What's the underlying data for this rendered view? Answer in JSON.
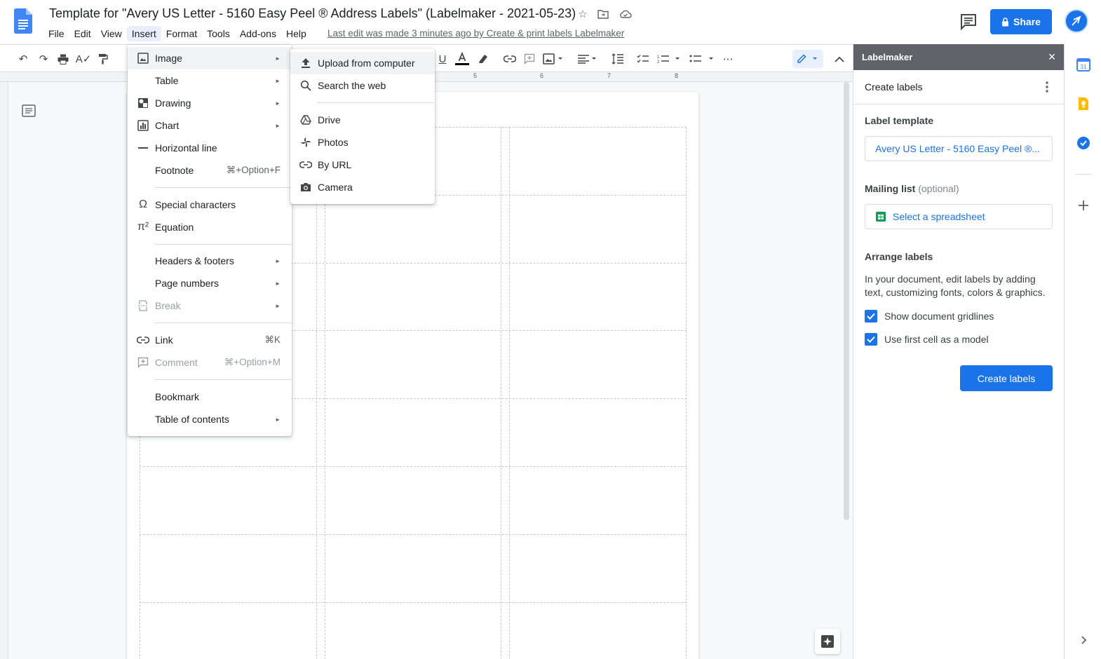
{
  "header": {
    "title": "Template for \"Avery US Letter - 5160 Easy Peel ® Address Labels\" (Labelmaker - 2021-05-23)",
    "menus": [
      "File",
      "Edit",
      "View",
      "Insert",
      "Format",
      "Tools",
      "Add-ons",
      "Help"
    ],
    "last_edit": "Last edit was made 3 minutes ago by Create & print labels Labelmaker",
    "share_label": "Share"
  },
  "ruler": {
    "numbers": [
      "5",
      "6",
      "7",
      "8"
    ]
  },
  "insert_menu": {
    "items": [
      {
        "label": "Image",
        "icon": "image-icon"
      },
      {
        "label": "Table"
      },
      {
        "label": "Drawing",
        "icon": "drawing-icon"
      },
      {
        "label": "Chart",
        "icon": "chart-icon"
      },
      {
        "label": "Horizontal line",
        "icon": "horizontal-line-icon"
      },
      {
        "label": "Footnote",
        "shortcut": "⌘+Option+F"
      },
      {
        "label": "Special characters",
        "icon": "omega-icon"
      },
      {
        "label": "Equation",
        "icon": "pi-icon"
      },
      {
        "label": "Headers & footers"
      },
      {
        "label": "Page numbers"
      },
      {
        "label": "Break",
        "icon": "break-icon"
      },
      {
        "label": "Link",
        "icon": "link-icon",
        "shortcut": "⌘K"
      },
      {
        "label": "Comment",
        "icon": "comment-icon",
        "shortcut": "⌘+Option+M"
      },
      {
        "label": "Bookmark"
      },
      {
        "label": "Table of contents"
      }
    ]
  },
  "image_submenu": {
    "items": [
      {
        "label": "Upload from computer",
        "icon": "upload-icon"
      },
      {
        "label": "Search the web",
        "icon": "search-icon"
      },
      {
        "label": "Drive",
        "icon": "drive-icon"
      },
      {
        "label": "Photos",
        "icon": "photos-icon"
      },
      {
        "label": "By URL",
        "icon": "link-icon"
      },
      {
        "label": "Camera",
        "icon": "camera-icon"
      }
    ]
  },
  "side_panel": {
    "title": "Labelmaker",
    "subheader": "Create labels",
    "label_template_heading": "Label template",
    "label_template_value": "Avery US Letter - 5160 Easy Peel ®...",
    "mailing_list_heading": "Mailing list",
    "mailing_list_optional": "(optional)",
    "select_spreadsheet": "Select a spreadsheet",
    "arrange_heading": "Arrange labels",
    "arrange_desc": "In your document, edit labels by adding text, customizing fonts, colors & graphics.",
    "show_gridlines": "Show document gridlines",
    "use_first_cell": "Use first cell as a model",
    "create_button": "Create labels"
  },
  "colors": {
    "accent": "#1a73e8",
    "panel_header": "#5f6368"
  }
}
